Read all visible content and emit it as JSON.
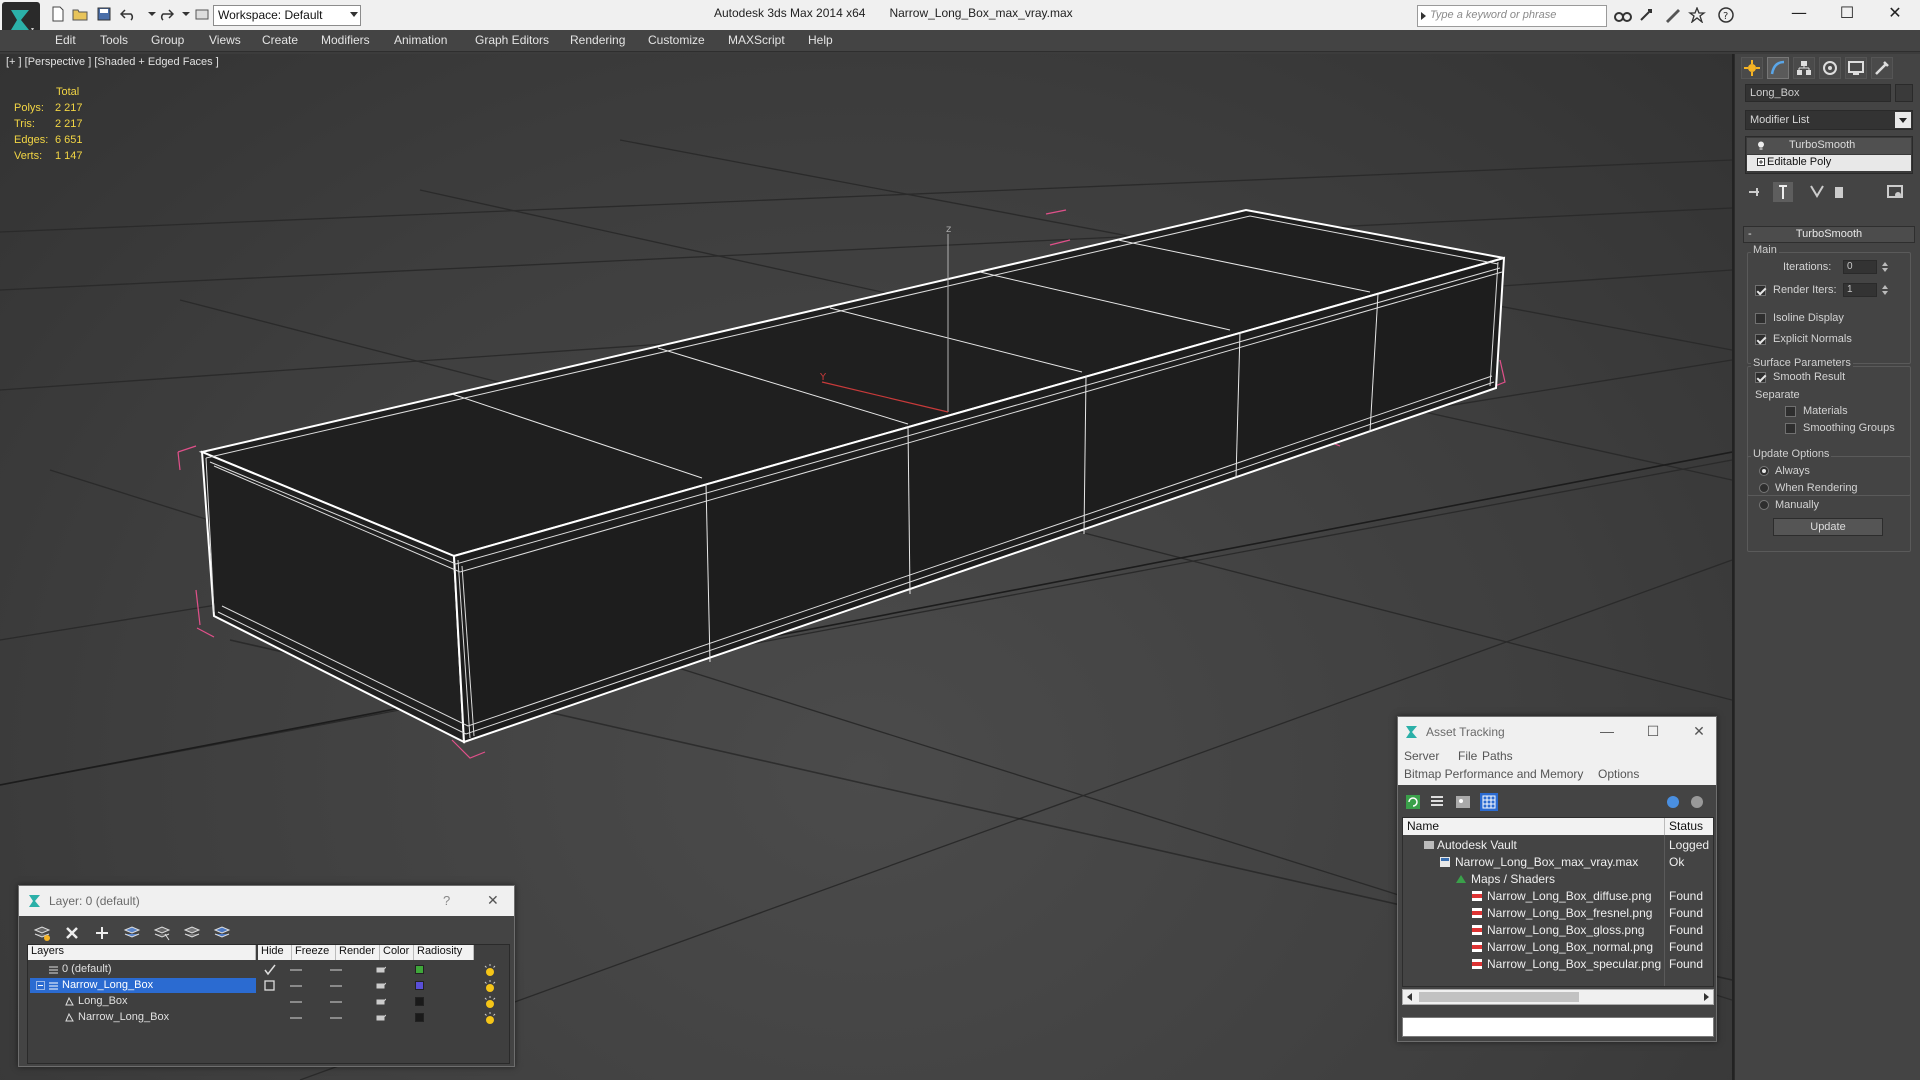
{
  "app": {
    "title": "Autodesk 3ds Max  2014 x64",
    "file": "Narrow_Long_Box_max_vray.max",
    "workspace": "Workspace: Default",
    "search_placeholder": "Type a keyword or phrase"
  },
  "window_controls": {
    "minimize": "—",
    "maximize": "☐",
    "close": "✕"
  },
  "menu": [
    "Edit",
    "Tools",
    "Group",
    "Views",
    "Create",
    "Modifiers",
    "Animation",
    "Graph Editors",
    "Rendering",
    "Customize",
    "MAXScript",
    "Help"
  ],
  "viewport": {
    "label": "[+ ] [Perspective ] [Shaded + Edged Faces ]",
    "stats": {
      "header": "Total",
      "rows": [
        {
          "key": "Polys:",
          "value": "2 217"
        },
        {
          "key": "Tris:",
          "value": "2 217"
        },
        {
          "key": "Edges:",
          "value": "6 651"
        },
        {
          "key": "Verts:",
          "value": "1 147"
        }
      ]
    },
    "axis_labels": {
      "z": "z",
      "y": "Y"
    }
  },
  "command_panel": {
    "object_name": "Long_Box",
    "modifier_list": "Modifier List",
    "stack": [
      "TurboSmooth",
      "Editable Poly"
    ],
    "rollout_title": "TurboSmooth",
    "main_group": "Main",
    "iterations_label": "Iterations:",
    "iterations_value": "0",
    "render_iters_label": "Render Iters:",
    "render_iters_value": "1",
    "render_iters_checked": true,
    "isoline_label": "Isoline Display",
    "isoline_checked": false,
    "explicit_normals_label": "Explicit Normals",
    "explicit_normals_checked": true,
    "surface_group": "Surface Parameters",
    "smooth_result_label": "Smooth Result",
    "smooth_result_checked": true,
    "separate_label": "Separate",
    "materials_label": "Materials",
    "smoothing_groups_label": "Smoothing Groups",
    "update_group": "Update Options",
    "update_options": [
      "Always",
      "When Rendering",
      "Manually"
    ],
    "update_selected": "Always",
    "update_button": "Update"
  },
  "asset_tracking": {
    "title": "Asset Tracking",
    "menu_row1": [
      "Server",
      "File",
      "Paths"
    ],
    "menu_row2": [
      "Bitmap Performance and Memory",
      "Options"
    ],
    "columns": [
      "Name",
      "Status"
    ],
    "rows": [
      {
        "name": "Autodesk Vault",
        "status": "Logged C",
        "indent": 0,
        "icon": "vault-icon"
      },
      {
        "name": "Narrow_Long_Box_max_vray.max",
        "status": "Ok",
        "indent": 1,
        "icon": "max-file-icon"
      },
      {
        "name": "Maps / Shaders",
        "status": "",
        "indent": 2,
        "icon": "maps-folder-icon"
      },
      {
        "name": "Narrow_Long_Box_diffuse.png",
        "status": "Found",
        "indent": 3,
        "icon": "png-icon"
      },
      {
        "name": "Narrow_Long_Box_fresnel.png",
        "status": "Found",
        "indent": 3,
        "icon": "png-icon"
      },
      {
        "name": "Narrow_Long_Box_gloss.png",
        "status": "Found",
        "indent": 3,
        "icon": "png-icon"
      },
      {
        "name": "Narrow_Long_Box_normal.png",
        "status": "Found",
        "indent": 3,
        "icon": "png-icon"
      },
      {
        "name": "Narrow_Long_Box_specular.png",
        "status": "Found",
        "indent": 3,
        "icon": "png-icon"
      }
    ]
  },
  "layer_dialog": {
    "title": "Layer: 0 (default)",
    "help": "?",
    "close": "✕",
    "columns": [
      "Layers",
      "Hide",
      "Freeze",
      "Render",
      "Color",
      "Radiosity"
    ],
    "rows": [
      {
        "name": "0 (default)",
        "indent": 0,
        "color": "#3fa83a",
        "selected": false,
        "current": true
      },
      {
        "name": "Narrow_Long_Box",
        "indent": 0,
        "color": "#5a4fd8",
        "selected": true,
        "current": false
      },
      {
        "name": "Long_Box",
        "indent": 1,
        "color": "#1a1a1a",
        "selected": false,
        "current": false
      },
      {
        "name": "Narrow_Long_Box",
        "indent": 1,
        "color": "#1a1a1a",
        "selected": false,
        "current": false
      }
    ]
  },
  "colors": {
    "viewport_bg": "#3e3e3e",
    "selection_bracket": "#e0508a",
    "stats_text": "#f2d544",
    "selected_row": "#2b6bd1"
  }
}
